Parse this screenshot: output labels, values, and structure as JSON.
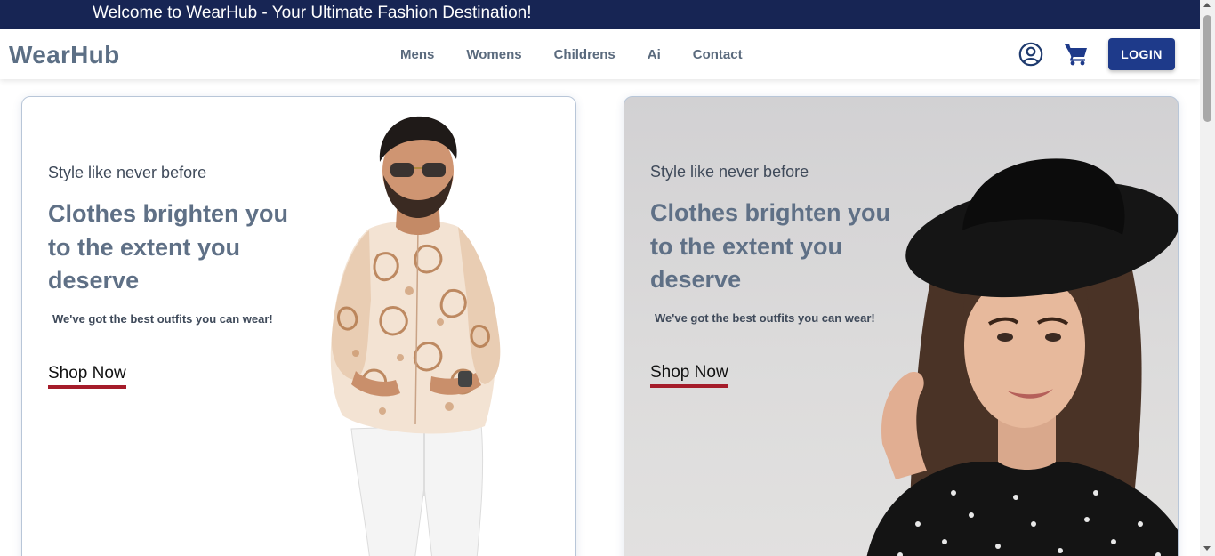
{
  "announcement": {
    "text": "Welcome to WearHub - Your Ultimate Fashion Destination!"
  },
  "header": {
    "logo": "WearHub",
    "nav": [
      "Mens",
      "Womens",
      "Childrens",
      "Ai",
      "Contact"
    ],
    "login_label": "LOGIN",
    "icons": {
      "account": "user-circle-icon",
      "cart": "shopping-cart-icon"
    }
  },
  "hero": {
    "cards": [
      {
        "eyebrow": "Style like never before",
        "headline": "Clothes brighten you to the extent you deserve",
        "subline": "We've got the best outfits you can wear!",
        "cta": "Shop Now",
        "image": "man-in-paisley-shirt"
      },
      {
        "eyebrow": "Style like never before",
        "headline": "Clothes brighten you to the extent you deserve",
        "subline": "We've got the best outfits you can wear!",
        "cta": "Shop Now",
        "image": "woman-in-black-hat"
      }
    ]
  },
  "colors": {
    "announcement_bg": "#172554",
    "login_bg": "#1e3a8a",
    "logo": "#5c6f85",
    "headline": "#5f7086",
    "cta_underline": "#a51c2a"
  }
}
